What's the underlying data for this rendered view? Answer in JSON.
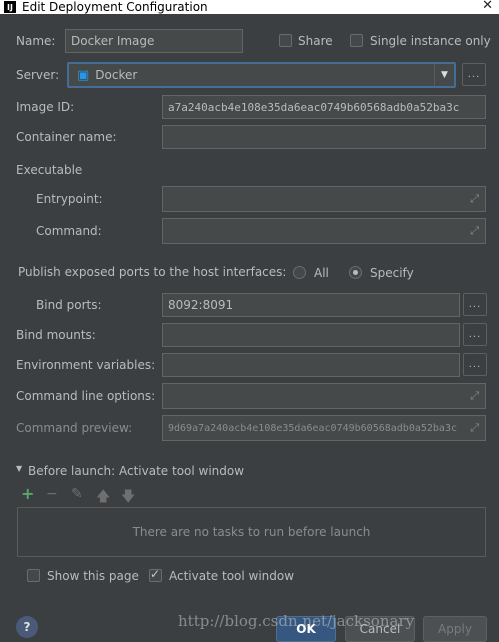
{
  "window": {
    "title": "Edit Deployment Configuration",
    "close_glyph": "✕"
  },
  "form": {
    "name_label": "Name:",
    "name_value": "Docker Image",
    "share_label": "Share",
    "single_instance_label": "Single instance only",
    "server_label": "Server:",
    "server_value": "Docker",
    "image_id_label": "Image ID:",
    "image_id_value": "a7a240acb4e108e35da6eac0749b60568adb0a52ba3c",
    "container_name_label": "Container name:",
    "container_name_value": "",
    "executable_section": "Executable",
    "entrypoint_label": "Entrypoint:",
    "command_label": "Command:",
    "publish_label": "Publish exposed ports to the host interfaces:",
    "publish_all_label": "All",
    "publish_specify_label": "Specify",
    "bind_ports_label": "Bind ports:",
    "bind_ports_value": "8092:8091",
    "bind_mounts_label": "Bind mounts:",
    "env_vars_label": "Environment variables:",
    "cmd_options_label": "Command line options:",
    "cmd_preview_label": "Command preview:",
    "cmd_preview_value": "9d69a7a240acb4e108e35da6eac0749b60568adb0a52ba3c",
    "dots_label": "..."
  },
  "before_launch": {
    "title": "Before launch: Activate tool window",
    "empty_text": "There are no tasks to run before launch"
  },
  "footer": {
    "show_page_label": "Show this page",
    "activate_tool_label": "Activate tool window",
    "help_label": "?",
    "ok_label": "OK",
    "cancel_label": "Cancel",
    "apply_label": "Apply"
  },
  "watermark": "http://blog.csdn.net/jacksonary",
  "colors": {
    "background": "#3c3f41",
    "field": "#45494a",
    "focus_border": "#466d94",
    "docker_blue": "#2496ed",
    "add_green": "#59a869"
  }
}
